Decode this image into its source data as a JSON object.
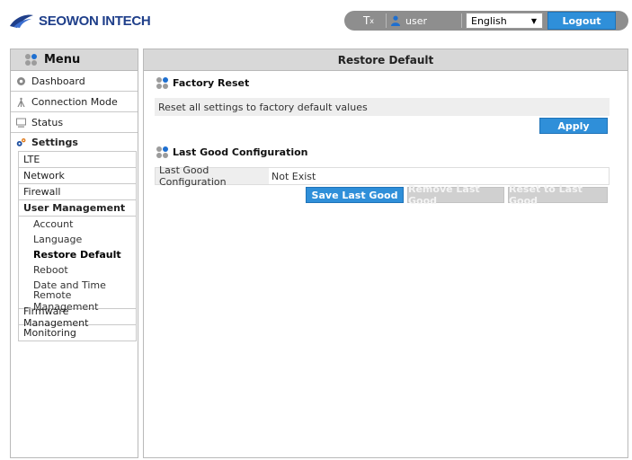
{
  "header": {
    "logo_text": "SEOWON INTECH",
    "clear_icon_label": "T",
    "clear_icon_sub": "x",
    "user_label": "user",
    "language_selected": "English",
    "logout_label": "Logout"
  },
  "sidebar": {
    "title": "Menu",
    "items": [
      {
        "label": "Dashboard",
        "icon": "gear-icon"
      },
      {
        "label": "Connection Mode",
        "icon": "antenna-icon"
      },
      {
        "label": "Status",
        "icon": "monitor-icon"
      }
    ],
    "settings_label": "Settings",
    "settings_sub": [
      {
        "label": "LTE"
      },
      {
        "label": "Network"
      },
      {
        "label": "Firewall"
      },
      {
        "label": "User Management"
      }
    ],
    "user_management_sub": [
      "Account",
      "Language",
      "Restore Default",
      "Reboot",
      "Date and Time",
      "Remote Management"
    ],
    "after_sub": [
      {
        "label": "Firmware Management"
      },
      {
        "label": "Monitoring"
      }
    ]
  },
  "main": {
    "title": "Restore Default",
    "factory_reset": {
      "title": "Factory Reset",
      "description": "Reset all settings to factory default values",
      "apply_label": "Apply"
    },
    "last_good": {
      "title": "Last Good Configuration",
      "row_label": "Last Good Configuration",
      "row_value": "Not Exist",
      "save_label": "Save Last Good",
      "remove_label": "Remove Last Good",
      "reset_label": "Reset to Last Good"
    }
  },
  "colors": {
    "accent_blue": "#2f8fd9",
    "logo_blue": "#1f3f8a",
    "panel_header": "#d8d8d8",
    "topbar_gray": "#8e8e8e",
    "disabled_button": "#d0d0d0"
  }
}
